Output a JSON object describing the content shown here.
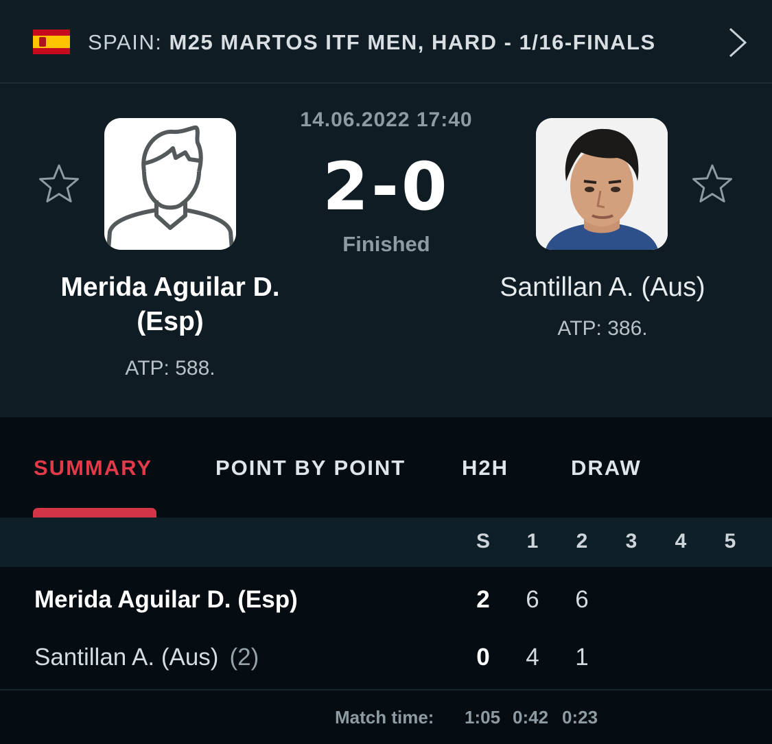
{
  "tournament": {
    "country": "SPAIN:",
    "name": "M25 MARTOS ITF MEN, HARD - 1/16-FINALS",
    "flag_icon": "spain-flag-icon",
    "next_icon": "chevron-right-icon"
  },
  "match": {
    "datetime": "14.06.2022 17:40",
    "score": "2-0",
    "status": "Finished",
    "home": {
      "name": "Merida Aguilar D. (Esp)",
      "rank": "ATP: 588.",
      "avatar_icon": "player-silhouette-icon"
    },
    "away": {
      "name": "Santillan A. (Aus)",
      "rank": "ATP: 386.",
      "avatar_icon": "player-photo"
    }
  },
  "tabs": [
    {
      "label": "SUMMARY",
      "active": true
    },
    {
      "label": "POINT BY POINT",
      "active": false
    },
    {
      "label": "H2H",
      "active": false
    },
    {
      "label": "DRAW",
      "active": false
    }
  ],
  "scoreboard": {
    "columns": [
      "S",
      "1",
      "2",
      "3",
      "4",
      "5"
    ],
    "rows": [
      {
        "name": "Merida Aguilar D. (Esp)",
        "seed": "",
        "sets": "2",
        "games": [
          "6",
          "6"
        ]
      },
      {
        "name": "Santillan A. (Aus)",
        "seed": "(2)",
        "sets": "0",
        "games": [
          "4",
          "1"
        ]
      }
    ],
    "match_time_label": "Match time:",
    "match_times": [
      "1:05",
      "0:42",
      "0:23"
    ]
  },
  "colors": {
    "accent": "#e33a4a",
    "background": "#0f1c24"
  }
}
